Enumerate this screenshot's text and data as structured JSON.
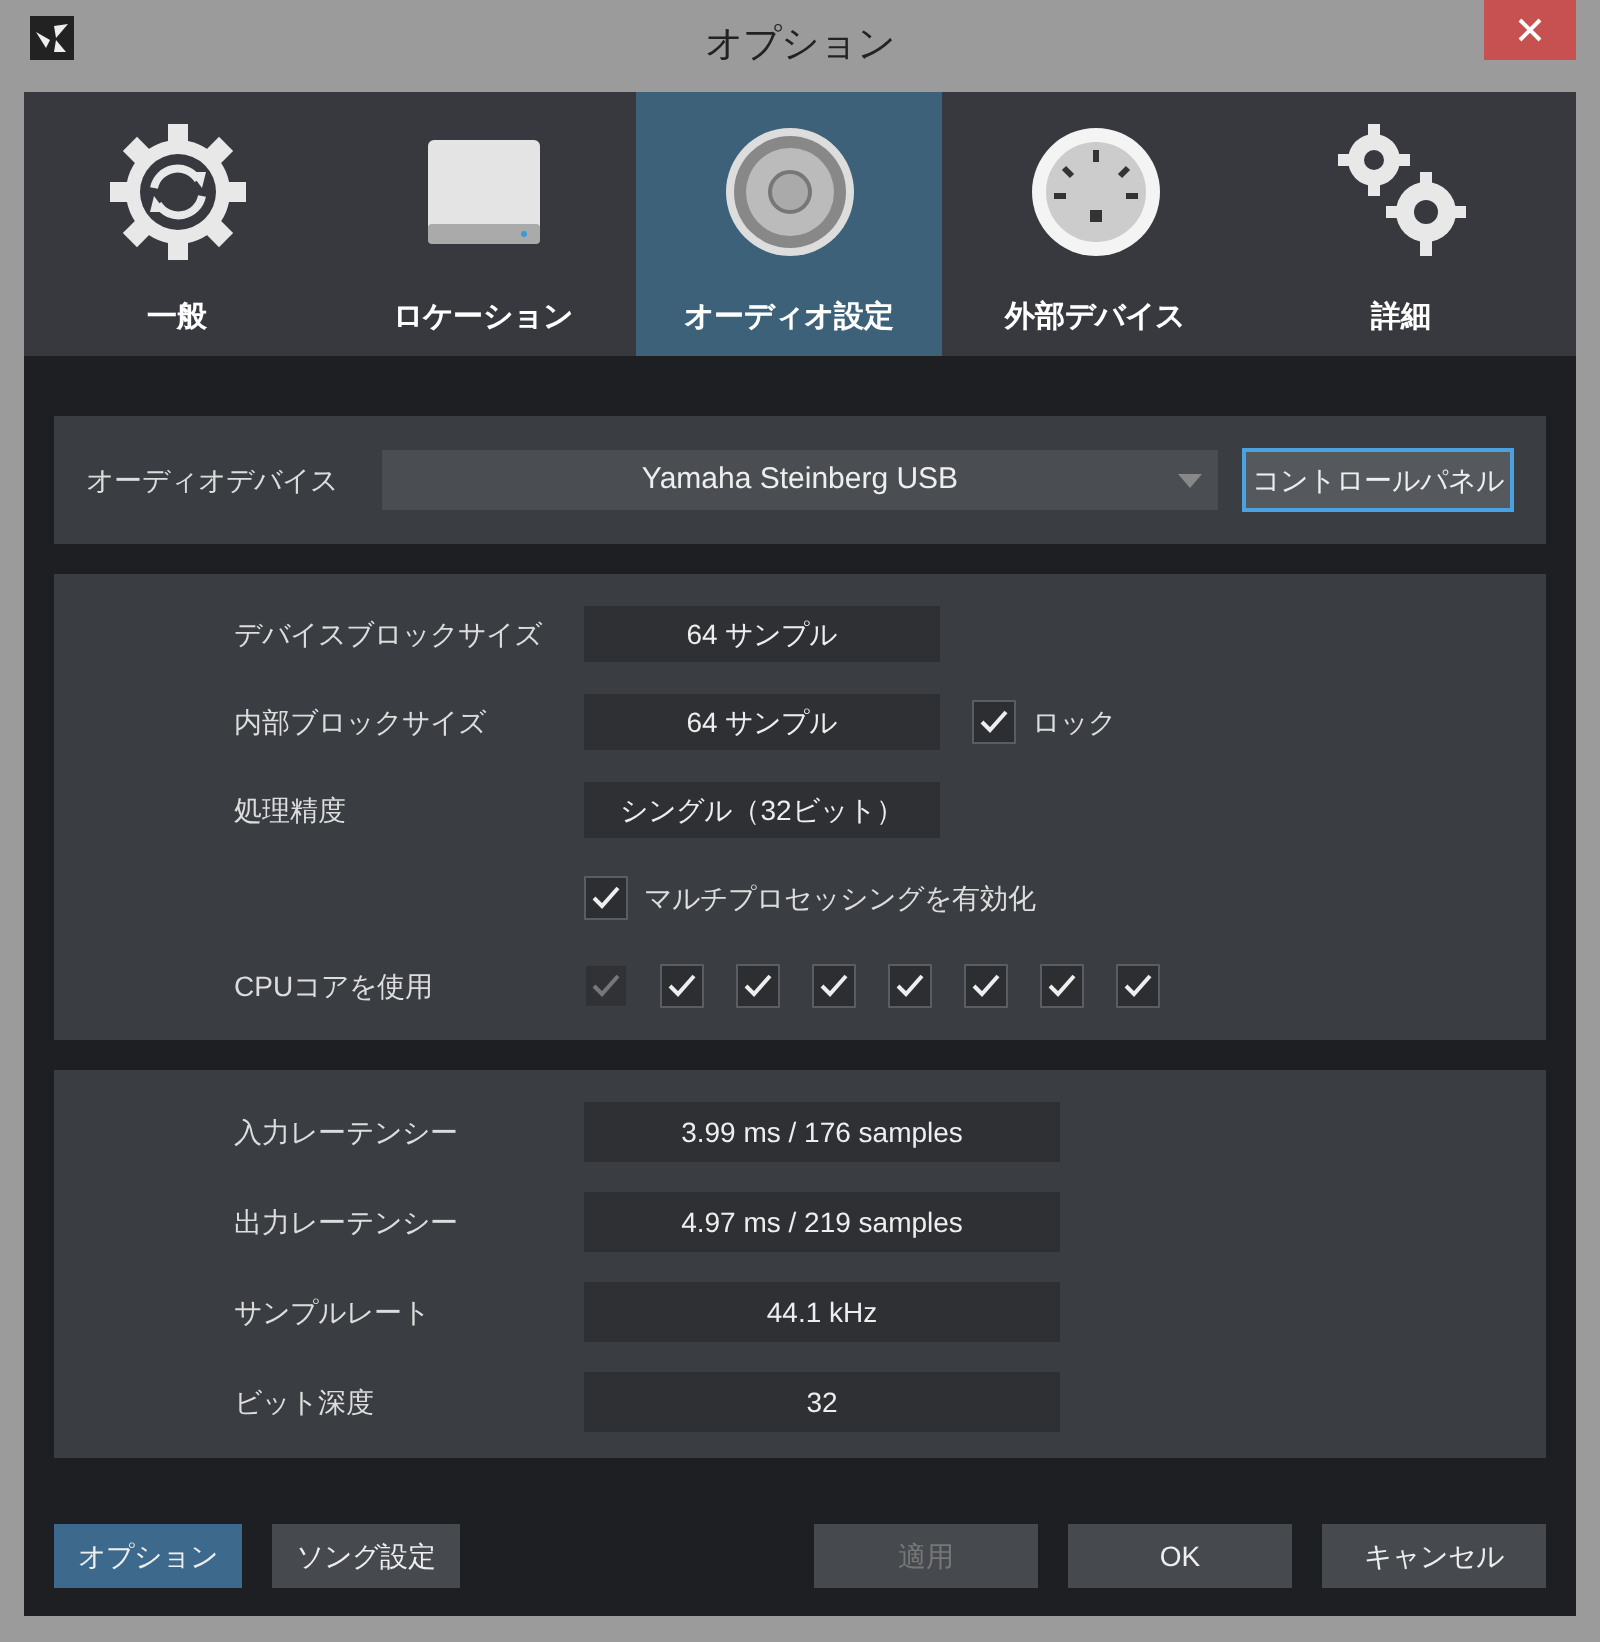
{
  "window": {
    "title": "オプション"
  },
  "tabs": [
    {
      "kind": "general",
      "label": "一般",
      "selected": false
    },
    {
      "kind": "locations",
      "label": "ロケーション",
      "selected": false
    },
    {
      "kind": "audio",
      "label": "オーディオ設定",
      "selected": true
    },
    {
      "kind": "external",
      "label": "外部デバイス",
      "selected": false
    },
    {
      "kind": "advanced",
      "label": "詳細",
      "selected": false
    }
  ],
  "audio_device": {
    "label": "オーディオデバイス",
    "value": "Yamaha Steinberg USB",
    "button": "コントロールパネル"
  },
  "processing": [
    {
      "kind": "value",
      "label": "デバイスブロックサイズ",
      "value": "64 サンプル"
    },
    {
      "kind": "value",
      "label": "内部ブロックサイズ",
      "value": "64 サンプル",
      "lock": {
        "label": "ロック",
        "checked": true
      }
    },
    {
      "kind": "value",
      "label": "処理精度",
      "value": "シングル（32ビット）"
    },
    {
      "kind": "checkbox",
      "label": "マルチプロセッシングを有効化",
      "checked": true
    },
    {
      "kind": "cores",
      "label": "CPUコアを使用",
      "cores": [
        {
          "checked": true,
          "disabled": true
        },
        {
          "checked": true,
          "disabled": false
        },
        {
          "checked": true,
          "disabled": false
        },
        {
          "checked": true,
          "disabled": false
        },
        {
          "checked": true,
          "disabled": false
        },
        {
          "checked": true,
          "disabled": false
        },
        {
          "checked": true,
          "disabled": false
        },
        {
          "checked": true,
          "disabled": false
        }
      ]
    }
  ],
  "latency": [
    {
      "label": "入力レーテンシー",
      "value": "3.99 ms / 176 samples"
    },
    {
      "label": "出力レーテンシー",
      "value": "4.97 ms / 219 samples"
    },
    {
      "label": "サンプルレート",
      "value": "44.1 kHz"
    },
    {
      "label": "ビット深度",
      "value": "32"
    }
  ],
  "footer_left": [
    {
      "label": "オプション",
      "selected": true
    },
    {
      "label": "ソング設定",
      "selected": false
    }
  ],
  "footer_right": [
    {
      "label": "適用",
      "disabled": true
    },
    {
      "label": "OK",
      "disabled": false
    },
    {
      "label": "キャンセル",
      "disabled": false
    }
  ]
}
